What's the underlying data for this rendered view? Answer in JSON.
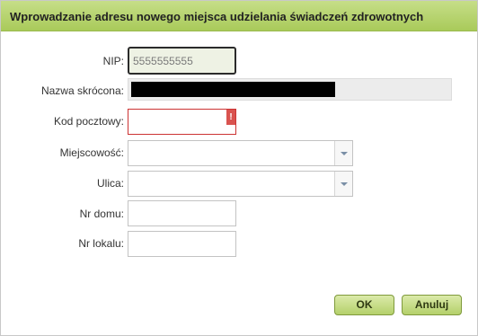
{
  "dialog": {
    "title": "Wprowadzanie adresu nowego miejsca udzielania świadczeń zdrowotnych"
  },
  "form": {
    "nip": {
      "label": "NIP:",
      "value": "5555555555"
    },
    "nazwa": {
      "label": "Nazwa skrócona:",
      "value_redacted": true
    },
    "kod": {
      "label": "Kod pocztowy:",
      "value": "",
      "error_marker": "!"
    },
    "miejscowosc": {
      "label": "Miejscowość:",
      "value": ""
    },
    "ulica": {
      "label": "Ulica:",
      "value": ""
    },
    "nr_domu": {
      "label": "Nr domu:",
      "value": ""
    },
    "nr_lokalu": {
      "label": "Nr lokalu:",
      "value": ""
    }
  },
  "buttons": {
    "ok": "OK",
    "cancel": "Anuluj"
  },
  "colors": {
    "titlebar": "#b3d06a",
    "error": "#d9534f",
    "button": "#c6de88"
  }
}
